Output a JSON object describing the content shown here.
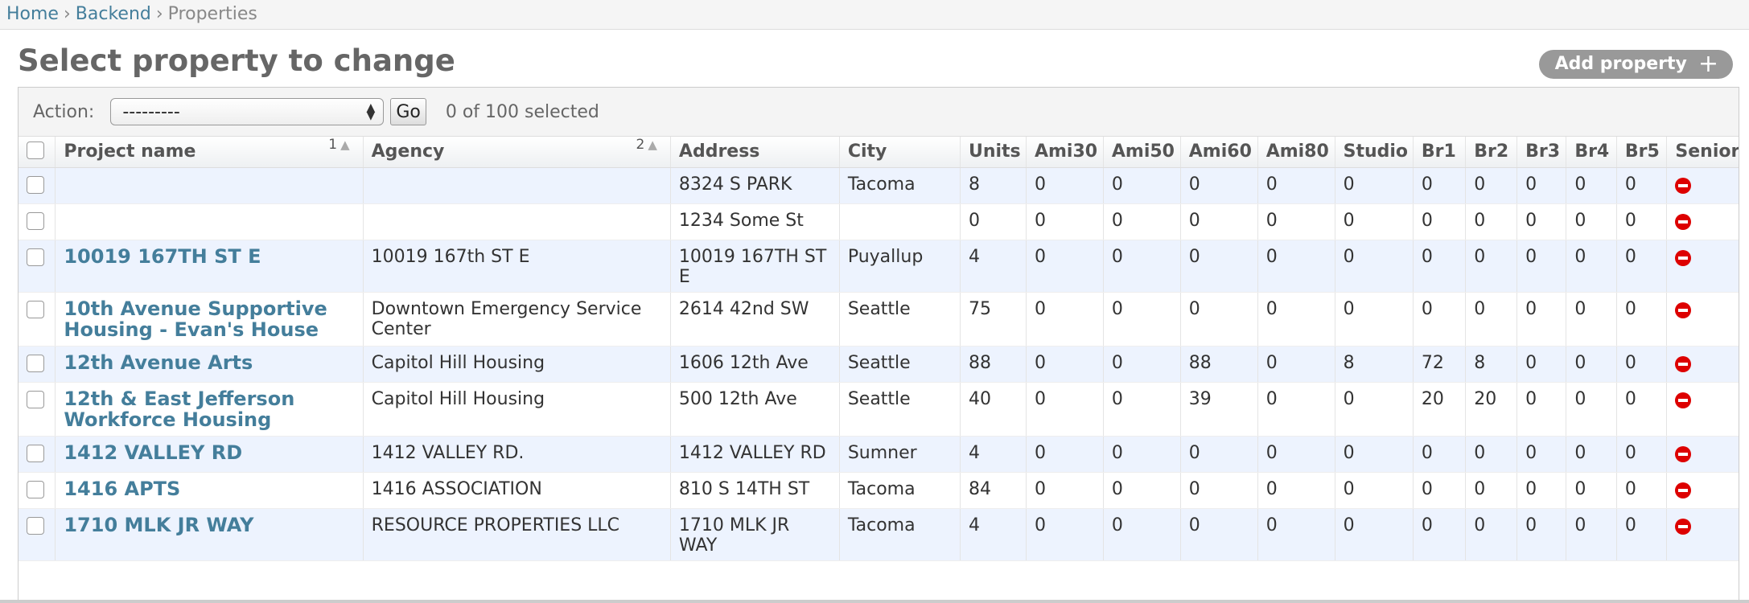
{
  "breadcrumbs": {
    "home": "Home",
    "backend": "Backend",
    "current": "Properties",
    "sep": "›"
  },
  "page_title": "Select property to change",
  "add_button": {
    "label": "Add property",
    "icon": "plus-icon"
  },
  "actions": {
    "label": "Action:",
    "selected": "---------",
    "go": "Go",
    "counter": "0 of 100 selected"
  },
  "columns": {
    "project_name": "Project name",
    "project_sort": "1",
    "agency": "Agency",
    "agency_sort": "2",
    "address": "Address",
    "city": "City",
    "units": "Units",
    "ami30": "Ami30",
    "ami50": "Ami50",
    "ami60": "Ami60",
    "ami80": "Ami80",
    "studio": "Studio",
    "br1": "Br1",
    "br2": "Br2",
    "br3": "Br3",
    "br4": "Br4",
    "br5": "Br5",
    "senior": "Senior"
  },
  "rows": [
    {
      "name": "",
      "agency": "",
      "address": "8324 S PARK",
      "city": "Tacoma",
      "units": "8",
      "ami30": "0",
      "ami50": "0",
      "ami60": "0",
      "ami80": "0",
      "studio": "0",
      "br1": "0",
      "br2": "0",
      "br3": "0",
      "br4": "0",
      "br5": "0",
      "senior": "no-icon"
    },
    {
      "name": "",
      "agency": "",
      "address": "1234 Some St",
      "city": "",
      "units": "0",
      "ami30": "0",
      "ami50": "0",
      "ami60": "0",
      "ami80": "0",
      "studio": "0",
      "br1": "0",
      "br2": "0",
      "br3": "0",
      "br4": "0",
      "br5": "0",
      "senior": "no-icon"
    },
    {
      "name": "10019 167TH ST E",
      "agency": "10019 167th ST E",
      "address": "10019 167TH ST E",
      "city": "Puyallup",
      "units": "4",
      "ami30": "0",
      "ami50": "0",
      "ami60": "0",
      "ami80": "0",
      "studio": "0",
      "br1": "0",
      "br2": "0",
      "br3": "0",
      "br4": "0",
      "br5": "0",
      "senior": "no-icon"
    },
    {
      "name": "10th Avenue Supportive Housing - Evan's House",
      "agency": "Downtown Emergency Service Center",
      "address": "2614 42nd SW",
      "city": "Seattle",
      "units": "75",
      "ami30": "0",
      "ami50": "0",
      "ami60": "0",
      "ami80": "0",
      "studio": "0",
      "br1": "0",
      "br2": "0",
      "br3": "0",
      "br4": "0",
      "br5": "0",
      "senior": "no-icon"
    },
    {
      "name": "12th Avenue Arts",
      "agency": "Capitol Hill Housing",
      "address": "1606 12th Ave",
      "city": "Seattle",
      "units": "88",
      "ami30": "0",
      "ami50": "0",
      "ami60": "88",
      "ami80": "0",
      "studio": "8",
      "br1": "72",
      "br2": "8",
      "br3": "0",
      "br4": "0",
      "br5": "0",
      "senior": "no-icon"
    },
    {
      "name": "12th & East Jefferson Workforce Housing",
      "agency": "Capitol Hill Housing",
      "address": "500 12th Ave",
      "city": "Seattle",
      "units": "40",
      "ami30": "0",
      "ami50": "0",
      "ami60": "39",
      "ami80": "0",
      "studio": "0",
      "br1": "20",
      "br2": "20",
      "br3": "0",
      "br4": "0",
      "br5": "0",
      "senior": "no-icon"
    },
    {
      "name": "1412 VALLEY RD",
      "agency": "1412 VALLEY RD.",
      "address": "1412 VALLEY RD",
      "city": "Sumner",
      "units": "4",
      "ami30": "0",
      "ami50": "0",
      "ami60": "0",
      "ami80": "0",
      "studio": "0",
      "br1": "0",
      "br2": "0",
      "br3": "0",
      "br4": "0",
      "br5": "0",
      "senior": "no-icon"
    },
    {
      "name": "1416 APTS",
      "agency": "1416 ASSOCIATION",
      "address": "810 S 14TH ST",
      "city": "Tacoma",
      "units": "84",
      "ami30": "0",
      "ami50": "0",
      "ami60": "0",
      "ami80": "0",
      "studio": "0",
      "br1": "0",
      "br2": "0",
      "br3": "0",
      "br4": "0",
      "br5": "0",
      "senior": "no-icon"
    },
    {
      "name": "1710 MLK JR WAY",
      "agency": "RESOURCE PROPERTIES LLC",
      "address": "1710 MLK JR WAY",
      "city": "Tacoma",
      "units": "4",
      "ami30": "0",
      "ami50": "0",
      "ami60": "0",
      "ami80": "0",
      "studio": "0",
      "br1": "0",
      "br2": "0",
      "br3": "0",
      "br4": "0",
      "br5": "0",
      "senior": "no-icon"
    }
  ]
}
